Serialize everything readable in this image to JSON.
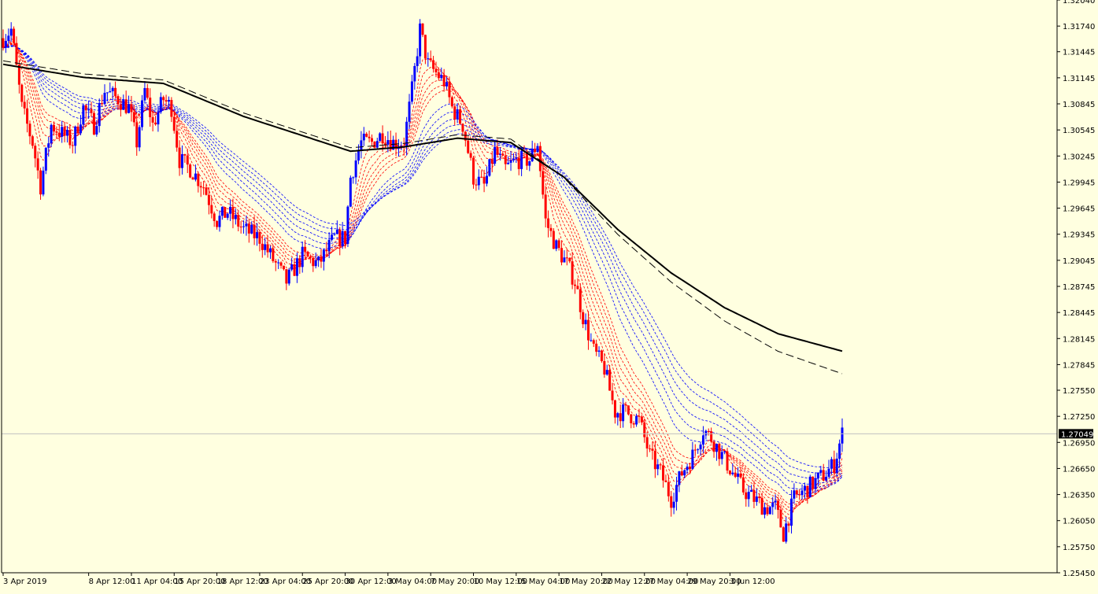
{
  "chart_data": {
    "type": "candlestick",
    "instrument_hint": "",
    "colors": {
      "background": "#ffffe0",
      "bull": "#0000ff",
      "bear": "#ff0000",
      "ma_long": "#000000",
      "fast_ribbon": "#ff0000",
      "slow_ribbon": "#0000ff",
      "axis": "#000000",
      "price_line": "#c0c0c0",
      "price_tag_bg": "#000000",
      "price_tag_fg": "#ffffff"
    },
    "y_axis": {
      "min": 1.2545,
      "max": 1.3204,
      "ticks": [
        "1.32040",
        "1.31740",
        "1.31445",
        "1.31145",
        "1.30845",
        "1.30545",
        "1.30245",
        "1.29945",
        "1.29645",
        "1.29345",
        "1.29045",
        "1.28745",
        "1.28445",
        "1.28145",
        "1.27845",
        "1.27550",
        "1.27250",
        "1.26950",
        "1.26650",
        "1.26350",
        "1.26050",
        "1.25750",
        "1.25450"
      ],
      "current_price": "1.27049"
    },
    "x_axis": {
      "labels": [
        "3 Apr 2019",
        "8 Apr 12:00",
        "11 Apr 04:00",
        "15 Apr 20:00",
        "18 Apr 12:00",
        "23 Apr 04:00",
        "25 Apr 20:00",
        "30 Apr 12:00",
        "3 May 04:00",
        "7 May 20:00",
        "10 May 12:00",
        "15 May 04:00",
        "17 May 20:00",
        "22 May 12:00",
        "27 May 04:00",
        "29 May 20:00",
        "3 Jun 12:00"
      ],
      "label_positions": [
        0,
        32,
        48,
        64,
        80,
        96,
        112,
        128,
        144,
        160,
        176,
        192,
        208,
        224,
        240,
        256,
        272
      ]
    },
    "path": [
      [
        0,
        1.316
      ],
      [
        3,
        1.317
      ],
      [
        7,
        1.308
      ],
      [
        11,
        1.304
      ],
      [
        14,
        1.299
      ],
      [
        18,
        1.306
      ],
      [
        22,
        1.305
      ],
      [
        26,
        1.304
      ],
      [
        30,
        1.308
      ],
      [
        34,
        1.306
      ],
      [
        38,
        1.31
      ],
      [
        43,
        1.309
      ],
      [
        47,
        1.308
      ],
      [
        50,
        1.304
      ],
      [
        53,
        1.31
      ],
      [
        56,
        1.306
      ],
      [
        60,
        1.309
      ],
      [
        63,
        1.308
      ],
      [
        66,
        1.302
      ],
      [
        70,
        1.301
      ],
      [
        75,
        1.299
      ],
      [
        80,
        1.295
      ],
      [
        84,
        1.296
      ],
      [
        90,
        1.294
      ],
      [
        96,
        1.293
      ],
      [
        100,
        1.291
      ],
      [
        106,
        1.288
      ],
      [
        112,
        1.291
      ],
      [
        118,
        1.29
      ],
      [
        124,
        1.293
      ],
      [
        128,
        1.293
      ],
      [
        130,
        1.3
      ],
      [
        134,
        1.304
      ],
      [
        138,
        1.304
      ],
      [
        142,
        1.305
      ],
      [
        146,
        1.304
      ],
      [
        150,
        1.304
      ],
      [
        153,
        1.31
      ],
      [
        156,
        1.317
      ],
      [
        159,
        1.313
      ],
      [
        162,
        1.312
      ],
      [
        165,
        1.311
      ],
      [
        168,
        1.308
      ],
      [
        172,
        1.306
      ],
      [
        176,
        1.3
      ],
      [
        180,
        1.299
      ],
      [
        184,
        1.303
      ],
      [
        188,
        1.301
      ],
      [
        192,
        1.302
      ],
      [
        197,
        1.302
      ],
      [
        200,
        1.304
      ],
      [
        203,
        1.295
      ],
      [
        207,
        1.292
      ],
      [
        211,
        1.29
      ],
      [
        214,
        1.288
      ],
      [
        217,
        1.284
      ],
      [
        221,
        1.28
      ],
      [
        225,
        1.278
      ],
      [
        229,
        1.273
      ],
      [
        233,
        1.273
      ],
      [
        238,
        1.272
      ],
      [
        242,
        1.268
      ],
      [
        246,
        1.266
      ],
      [
        250,
        1.263
      ],
      [
        254,
        1.266
      ],
      [
        258,
        1.268
      ],
      [
        262,
        1.271
      ],
      [
        265,
        1.27
      ],
      [
        269,
        1.268
      ],
      [
        273,
        1.266
      ],
      [
        277,
        1.264
      ],
      [
        281,
        1.263
      ],
      [
        285,
        1.262
      ],
      [
        289,
        1.262
      ],
      [
        292,
        1.259
      ],
      [
        296,
        1.263
      ],
      [
        300,
        1.264
      ],
      [
        304,
        1.265
      ],
      [
        308,
        1.266
      ],
      [
        311,
        1.267
      ],
      [
        314,
        1.2705
      ]
    ],
    "ma_long_path": [
      [
        0,
        1.313
      ],
      [
        30,
        1.3115
      ],
      [
        60,
        1.3108
      ],
      [
        90,
        1.307
      ],
      [
        110,
        1.305
      ],
      [
        130,
        1.303
      ],
      [
        150,
        1.3035
      ],
      [
        170,
        1.3045
      ],
      [
        190,
        1.304
      ],
      [
        210,
        1.3
      ],
      [
        230,
        1.294
      ],
      [
        250,
        1.289
      ],
      [
        270,
        1.285
      ],
      [
        290,
        1.282
      ],
      [
        314,
        1.28
      ]
    ]
  }
}
